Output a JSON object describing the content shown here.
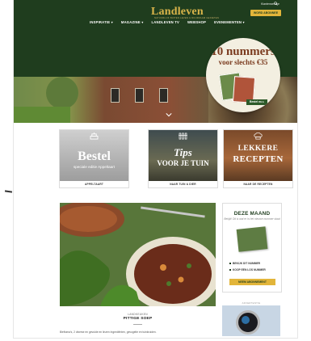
{
  "header": {
    "logo_text": "Landleven",
    "logo_tagline": "NATUURLIJK BUITEN LEVEN & DUURZAAM GENIETEN",
    "top_link": "Klantenservice",
    "subscribe_label": "WORD ABONNEE",
    "nav": [
      {
        "label": "INSPIRATIE",
        "has_dropdown": true
      },
      {
        "label": "MAGAZINE",
        "has_dropdown": true
      },
      {
        "label": "LANDLEVEN TV",
        "has_dropdown": false
      },
      {
        "label": "WEBSHOP",
        "has_dropdown": false
      },
      {
        "label": "EVENEMENTEN",
        "has_dropdown": true
      }
    ],
    "dropdown_glyph": "▾"
  },
  "promo": {
    "line1": "10 nummers",
    "line2": "voor slechts €35",
    "button": "Bestel nu ▸"
  },
  "cards": [
    {
      "big": "Bestel",
      "small": "speciale editie Appeltaart",
      "label": "APPELTAART",
      "icon": "cake-icon"
    },
    {
      "big": "Tips",
      "big2": "VOOR JE TUIN",
      "label": "NAAR TUIN & DIER",
      "icon": "fence-icon"
    },
    {
      "big": "LEKKERE",
      "big2": "RECEPTEN",
      "label": "NAAR DE RECEPTEN",
      "icon": "chef-hat-icon"
    }
  ],
  "article": {
    "category": "LANDKEUKEN",
    "title": "PITTIGE SOEP",
    "teaser": "Bieftoma's, 2 diverse en gevulde en linzen Ingrediënten, gevogelte en tuinkruiden."
  },
  "sidebar": {
    "title": "DEZE MAAND",
    "subtitle": "Bekijk! Dit is wat er in het nieuwe nummer staat",
    "links": [
      "BEKIJK DIT NUMMER",
      "KOOP EEN LOS NUMMER"
    ],
    "button": "NEEM ABONNEMENT"
  },
  "ad": {
    "label": "ADVERTENTIE"
  },
  "colors": {
    "header_green": "#1f3d1e",
    "accent_gold": "#e2b53a",
    "promo_red": "#7a3a1e"
  }
}
